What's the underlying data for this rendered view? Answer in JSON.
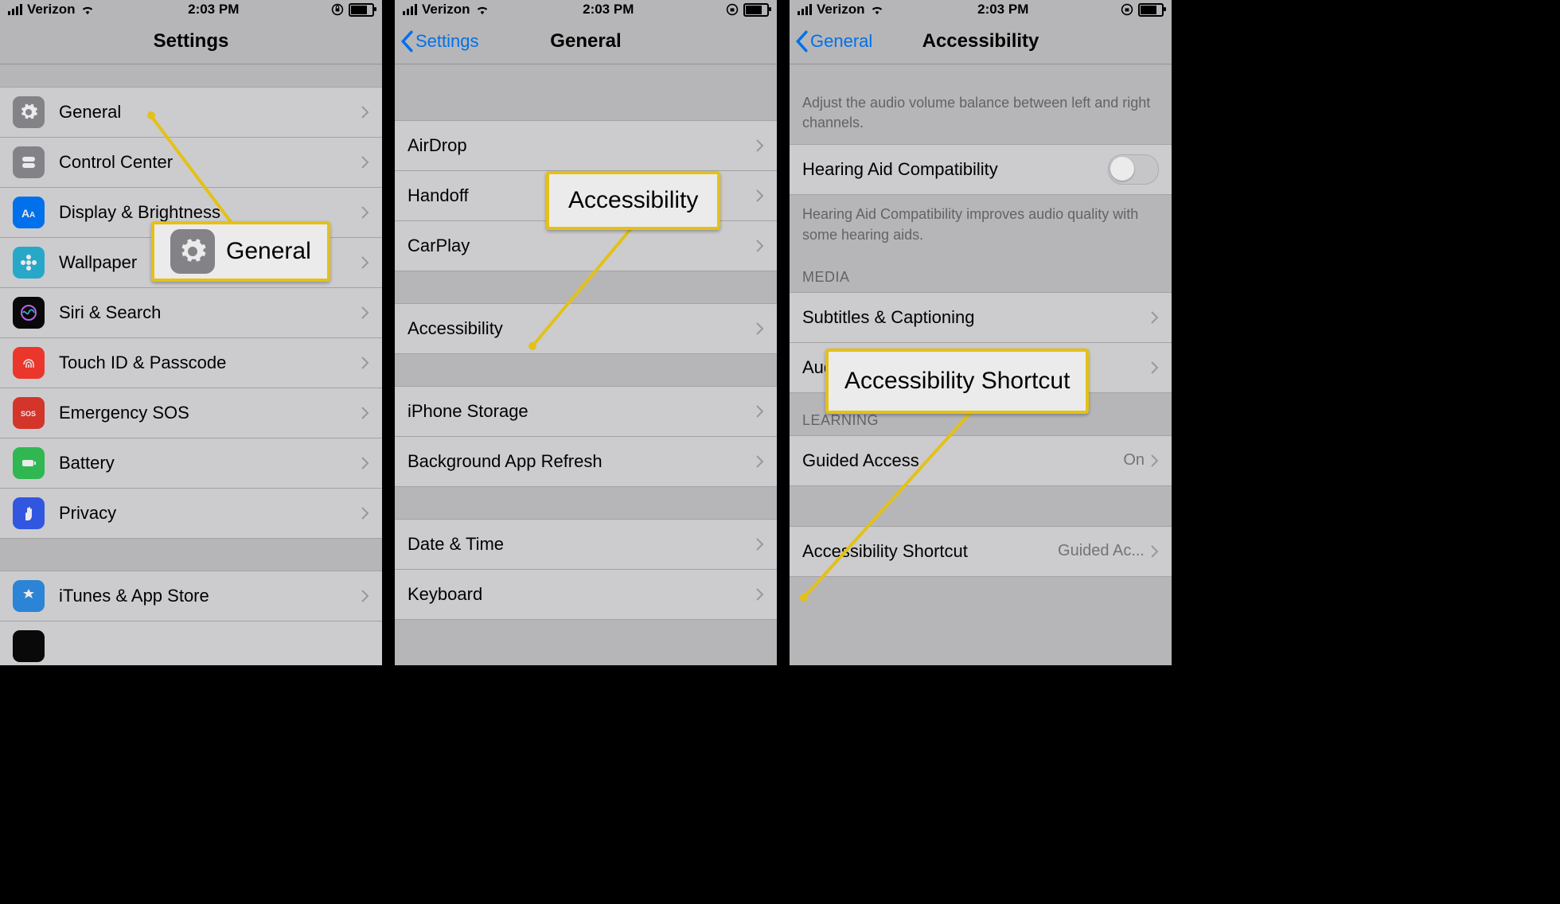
{
  "status": {
    "carrier": "Verizon",
    "time": "2:03 PM"
  },
  "screen1": {
    "title": "Settings",
    "rows": [
      {
        "label": "General"
      },
      {
        "label": "Control Center"
      },
      {
        "label": "Display & Brightness"
      },
      {
        "label": "Wallpaper"
      },
      {
        "label": "Siri & Search"
      },
      {
        "label": "Touch ID & Passcode"
      },
      {
        "label": "Emergency SOS"
      },
      {
        "label": "Battery"
      },
      {
        "label": "Privacy"
      },
      {
        "label": "iTunes & App Store"
      }
    ],
    "callout": "General"
  },
  "screen2": {
    "back": "Settings",
    "title": "General",
    "groups": [
      [
        {
          "label": "AirDrop"
        },
        {
          "label": "Handoff"
        },
        {
          "label": "CarPlay"
        }
      ],
      [
        {
          "label": "Accessibility"
        }
      ],
      [
        {
          "label": "iPhone Storage"
        },
        {
          "label": "Background App Refresh"
        }
      ],
      [
        {
          "label": "Date & Time"
        },
        {
          "label": "Keyboard"
        }
      ]
    ],
    "callout": "Accessibility"
  },
  "screen3": {
    "back": "General",
    "title": "Accessibility",
    "note1": "Adjust the audio volume balance between left and right channels.",
    "hearing": "Hearing Aid Compatibility",
    "note2": "Hearing Aid Compatibility improves audio quality with some hearing aids.",
    "media_head": "MEDIA",
    "media_rows": [
      {
        "label": "Subtitles & Captioning"
      },
      {
        "label": "Audio Descriptions"
      }
    ],
    "learn_head": "LEARNING",
    "guided": {
      "label": "Guided Access",
      "val": "On"
    },
    "shortcut": {
      "label": "Accessibility Shortcut",
      "val": "Guided Ac..."
    },
    "callout": "Accessibility Shortcut"
  }
}
